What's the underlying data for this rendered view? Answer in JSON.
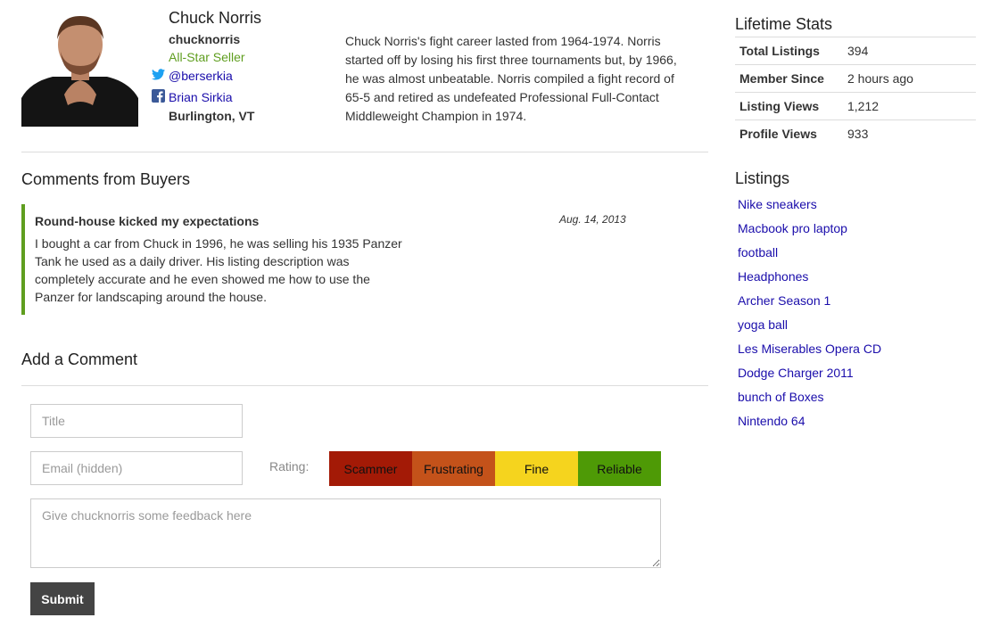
{
  "profile": {
    "name": "Chuck Norris",
    "username": "chucknorris",
    "badge": "All-Star Seller",
    "twitter": "@berserkia",
    "facebook": "Brian Sirkia",
    "location": "Burlington, VT",
    "bio": "Chuck Norris's fight career lasted from 1964-1974. Norris started off by losing his first three tournaments but, by 1966, he was almost unbeatable. Norris compiled a fight record of 65-5 and retired as undefeated Professional Full-Contact Middleweight Champion in 1974."
  },
  "comments": {
    "heading": "Comments from Buyers",
    "items": [
      {
        "title": "Round-house kicked my expectations",
        "date": "Aug. 14, 2013",
        "body": "I bought a car from Chuck in 1996, he was selling his 1935 Panzer Tank he used as a daily driver. His listing description was completely accurate and he even showed me how to use the Panzer for landscaping around the house."
      }
    ]
  },
  "form": {
    "heading": "Add a Comment",
    "title_placeholder": "Title",
    "email_placeholder": "Email (hidden)",
    "rating_label": "Rating:",
    "ratings": [
      {
        "label": "Scammer",
        "color": "#a31a06"
      },
      {
        "label": "Frustrating",
        "color": "#c4521a"
      },
      {
        "label": "Fine",
        "color": "#f5d41e"
      },
      {
        "label": "Reliable",
        "color": "#4e9a06"
      }
    ],
    "feedback_placeholder": "Give chucknorris some feedback here",
    "submit_label": "Submit"
  },
  "stats": {
    "heading": "Lifetime Stats",
    "rows": [
      {
        "label": "Total Listings",
        "value": "394"
      },
      {
        "label": "Member Since",
        "value": "2 hours ago"
      },
      {
        "label": "Listing Views",
        "value": "1,212"
      },
      {
        "label": "Profile Views",
        "value": "933"
      }
    ]
  },
  "listings": {
    "heading": "Listings",
    "items": [
      "Nike sneakers",
      "Macbook pro laptop",
      "football",
      "Headphones",
      "Archer Season 1",
      "yoga ball",
      "Les Miserables Opera CD",
      "Dodge Charger 2011",
      "bunch of Boxes",
      "Nintendo 64"
    ]
  },
  "colors": {
    "accent_green": "#5f9e1f",
    "link_blue": "#1a0dab",
    "twitter_blue": "#1da1f2",
    "facebook_blue": "#3b5998",
    "submit_gray": "#444444"
  }
}
